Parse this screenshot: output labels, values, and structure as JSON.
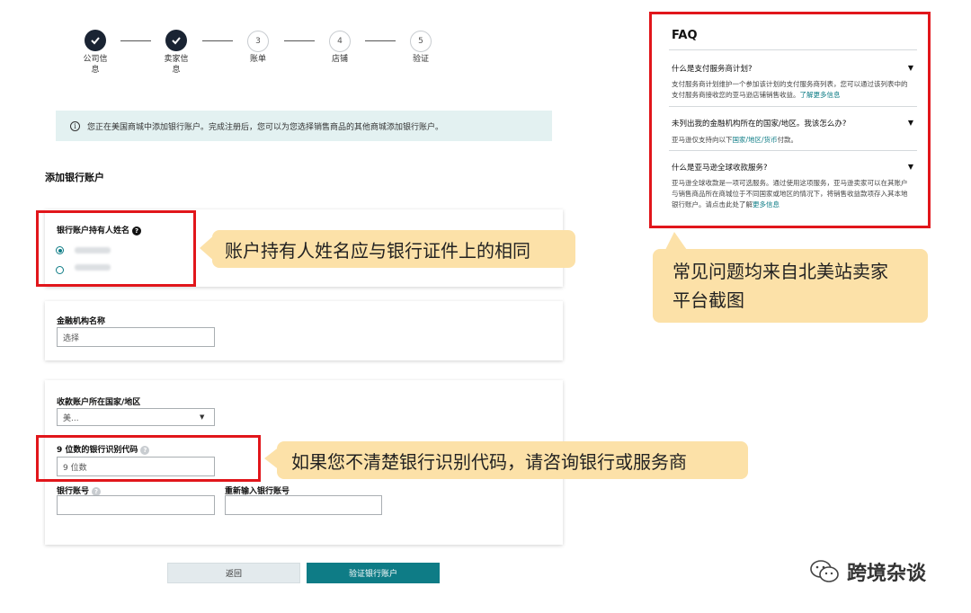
{
  "steps": [
    {
      "label": "公司信\n息",
      "done": true
    },
    {
      "label": "卖家信\n息",
      "done": true
    },
    {
      "label": "账单",
      "number": "3"
    },
    {
      "label": "店铺",
      "number": "4"
    },
    {
      "label": "验证",
      "number": "5"
    }
  ],
  "banner": {
    "text": "您正在美国商城中添加银行账户。完成注册后，您可以为您选择销售商品的其他商城添加银行账户。"
  },
  "section_title": "添加银行账户",
  "holder": {
    "label": "银行账户持有人姓名"
  },
  "institution": {
    "label": "金融机构名称",
    "value": "选择"
  },
  "country": {
    "label": "收款账户所在国家/地区",
    "value": "美..."
  },
  "routing": {
    "label": "9 位数的银行识别代码",
    "placeholder": "9 位数"
  },
  "account": {
    "label": "银行账号"
  },
  "reenter": {
    "label": "重新输入银行账号"
  },
  "buttons": {
    "back": "返回",
    "verify": "验证银行账户"
  },
  "callouts": {
    "name": "账户持有人姓名应与银行证件上的相同",
    "faq_line1": "常见问题均来自北美站卖家",
    "faq_line2": "平台截图",
    "routing": "如果您不清楚银行识别代码，请咨询银行或服务商"
  },
  "faq": {
    "title": "FAQ",
    "items": [
      {
        "q": "什么是支付服务商计划?",
        "a": "支付服务商计划维护一个参加该计划的支付服务商列表，您可以通过该列表中的支付服务商接收您的亚马逊店铺销售收益。",
        "link": "了解更多信息"
      },
      {
        "q": "未列出我的金融机构所在的国家/地区。我该怎么办?",
        "a_pre": "亚马逊仅支持向以下",
        "link": "国家/地区/货币",
        "a_post": "付款。"
      },
      {
        "q": "什么是亚马逊全球收款服务?",
        "a": "亚马逊全球收款是一项可选服务。通过使用这项服务，亚马逊卖家可以在其账户与销售商品所在商城位于不同国家或地区的情况下，将销售收益款项存入其本地银行账户。请点击此处了解",
        "link": "更多信息"
      }
    ]
  },
  "watermark": "跨境杂谈",
  "colors": {
    "accent": "#0e7c86",
    "highlight": "#e1161b",
    "callout": "#fce1a8"
  }
}
